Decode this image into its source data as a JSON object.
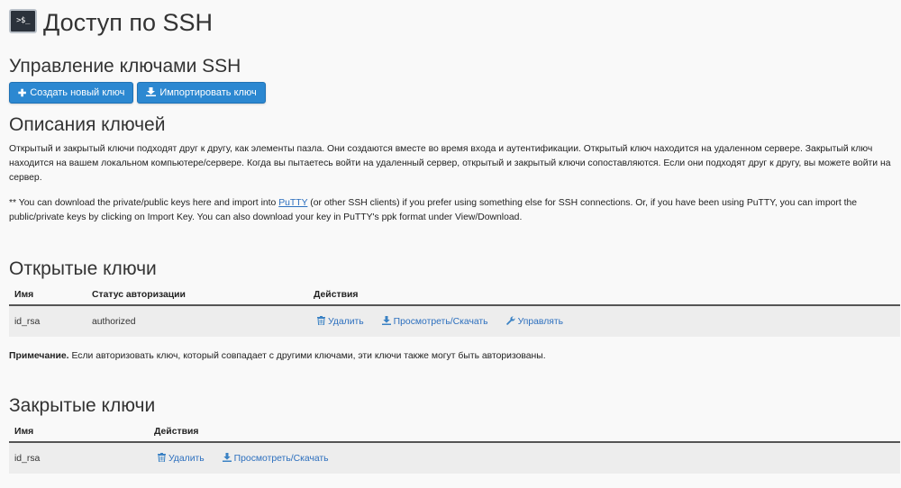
{
  "header": {
    "icon_text": ">$_",
    "title": "Доступ по SSH"
  },
  "manage": {
    "heading": "Управление ключами SSH",
    "create_button": "Создать новый ключ",
    "import_button": "Импортировать ключ"
  },
  "descriptions": {
    "heading": "Описания ключей",
    "paragraph1": "Открытый и закрытый ключи подходят друг к другу, как элементы пазла. Они создаются вместе во время входа и аутентификации. Открытый ключ находится на удаленном сервере. Закрытый ключ находится на вашем локальном компьютере/сервере. Когда вы пытаетесь войти на удаленный сервер, открытый и закрытый ключи сопоставляются. Если они подходят друг к другу, вы можете войти на сервер.",
    "paragraph2_before": "** You can download the private/public keys here and import into ",
    "putty_link": "PuTTY",
    "paragraph2_after": " (or other SSH clients) if you prefer using something else for SSH connections. Or, if you have been using PuTTY, you can import the public/private keys by clicking on Import Key. You can also download your key in PuTTY's ppk format under View/Download."
  },
  "public_keys": {
    "heading": "Открытые ключи",
    "columns": [
      "Имя",
      "Статус авторизации",
      "Действия"
    ],
    "rows": [
      {
        "name": "id_rsa",
        "status": "authorized",
        "actions": {
          "delete": "Удалить",
          "view": "Просмотреть/Скачать",
          "manage": "Управлять"
        }
      }
    ],
    "note_label": "Примечание.",
    "note_text": " Если авторизовать ключ, который совпадает с другими ключами, эти ключи также могут быть авторизованы."
  },
  "private_keys": {
    "heading": "Закрытые ключи",
    "columns": [
      "Имя",
      "Действия"
    ],
    "rows": [
      {
        "name": "id_rsa",
        "actions": {
          "delete": "Удалить",
          "view": "Просмотреть/Скачать"
        }
      }
    ]
  },
  "colors": {
    "accent": "#2c88d1",
    "link": "#2c6fbe"
  },
  "icons": {
    "create": "plus-icon",
    "import": "import-icon",
    "delete": "trash-icon",
    "view": "download-icon",
    "manage": "wrench-icon"
  }
}
